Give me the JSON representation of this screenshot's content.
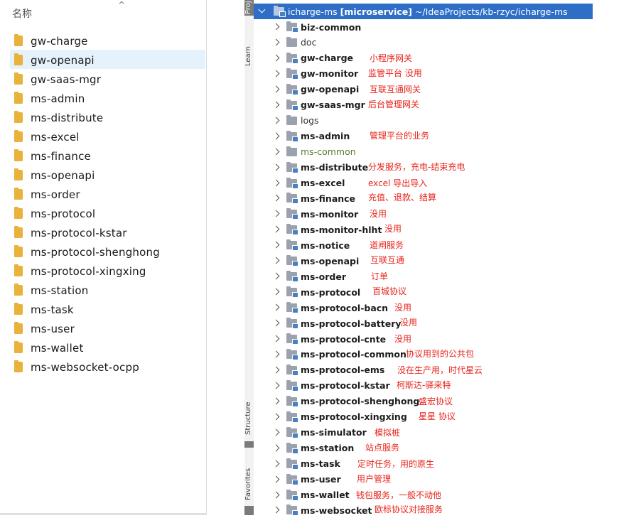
{
  "explorer": {
    "header": "名称",
    "sort_indicator": "^",
    "selected_index": 1,
    "items": [
      "gw-charge",
      "gw-openapi",
      "gw-saas-mgr",
      "ms-admin",
      "ms-distribute",
      "ms-excel",
      "ms-finance",
      "ms-openapi",
      "ms-order",
      "ms-protocol",
      "ms-protocol-kstar",
      "ms-protocol-shenghong",
      "ms-protocol-xingxing",
      "ms-station",
      "ms-task",
      "ms-user",
      "ms-wallet",
      "ms-websocket-ocpp"
    ]
  },
  "toolstrip": {
    "project": "Proj",
    "learn": "Learn",
    "structure": "Structure",
    "favorites": "Favorites"
  },
  "tree": {
    "root": {
      "name": "icharge-ms",
      "tag": "[microservice]",
      "path": "~/IdeaProjects/kb-rzyc/icharge-ms"
    },
    "items": [
      {
        "name": "biz-common",
        "style": "module",
        "note": ""
      },
      {
        "name": "doc",
        "style": "plain",
        "note": ""
      },
      {
        "name": "gw-charge",
        "style": "module",
        "note": "小程序网关"
      },
      {
        "name": "gw-monitor",
        "style": "module",
        "note": "监管平台 没用"
      },
      {
        "name": "gw-openapi",
        "style": "module",
        "note": "互联互通网关"
      },
      {
        "name": "gw-saas-mgr",
        "style": "module",
        "note": "后台管理网关"
      },
      {
        "name": "logs",
        "style": "plain",
        "note": ""
      },
      {
        "name": "ms-admin",
        "style": "module",
        "note": "管理平台的业务"
      },
      {
        "name": "ms-common",
        "style": "green",
        "note": ""
      },
      {
        "name": "ms-distribute",
        "style": "module",
        "note": "分发服务，充电-结束充电"
      },
      {
        "name": "ms-excel",
        "style": "module",
        "note": "excel 导出导入"
      },
      {
        "name": "ms-finance",
        "style": "module",
        "note": "充值、退款、结算"
      },
      {
        "name": "ms-monitor",
        "style": "module",
        "note": "没用"
      },
      {
        "name": "ms-monitor-hlht",
        "style": "module",
        "note": "没用"
      },
      {
        "name": "ms-notice",
        "style": "module",
        "note": "道闸服务"
      },
      {
        "name": "ms-openapi",
        "style": "module",
        "note": "互联互通"
      },
      {
        "name": "ms-order",
        "style": "module",
        "note": "订单"
      },
      {
        "name": "ms-protocol",
        "style": "module",
        "note": "百城协议"
      },
      {
        "name": "ms-protocol-bacn",
        "style": "module",
        "note": "没用"
      },
      {
        "name": "ms-protocol-battery",
        "style": "module",
        "note": "没用"
      },
      {
        "name": "ms-protocol-cnte",
        "style": "module",
        "note": "没用"
      },
      {
        "name": "ms-protocol-common",
        "style": "module",
        "note": "协议用到的公共包"
      },
      {
        "name": "ms-protocol-ems",
        "style": "module",
        "note": "没在生产用，时代星云"
      },
      {
        "name": "ms-protocol-kstar",
        "style": "module",
        "note": "柯斯达-驿来特"
      },
      {
        "name": "ms-protocol-shenghong",
        "style": "module",
        "note": "盛宏协议"
      },
      {
        "name": "ms-protocol-xingxing",
        "style": "module",
        "note": "星星 协议"
      },
      {
        "name": "ms-simulator",
        "style": "module",
        "note": "模拟桩"
      },
      {
        "name": "ms-station",
        "style": "module",
        "note": "站点服务"
      },
      {
        "name": "ms-task",
        "style": "module",
        "note": "定时任务，用的原生"
      },
      {
        "name": "ms-user",
        "style": "module",
        "note": "用户管理"
      },
      {
        "name": "ms-wallet",
        "style": "module",
        "note": "钱包服务，一般不动他"
      },
      {
        "name": "ms-websocket",
        "style": "module",
        "note": "欧标协议对接服务"
      }
    ]
  }
}
